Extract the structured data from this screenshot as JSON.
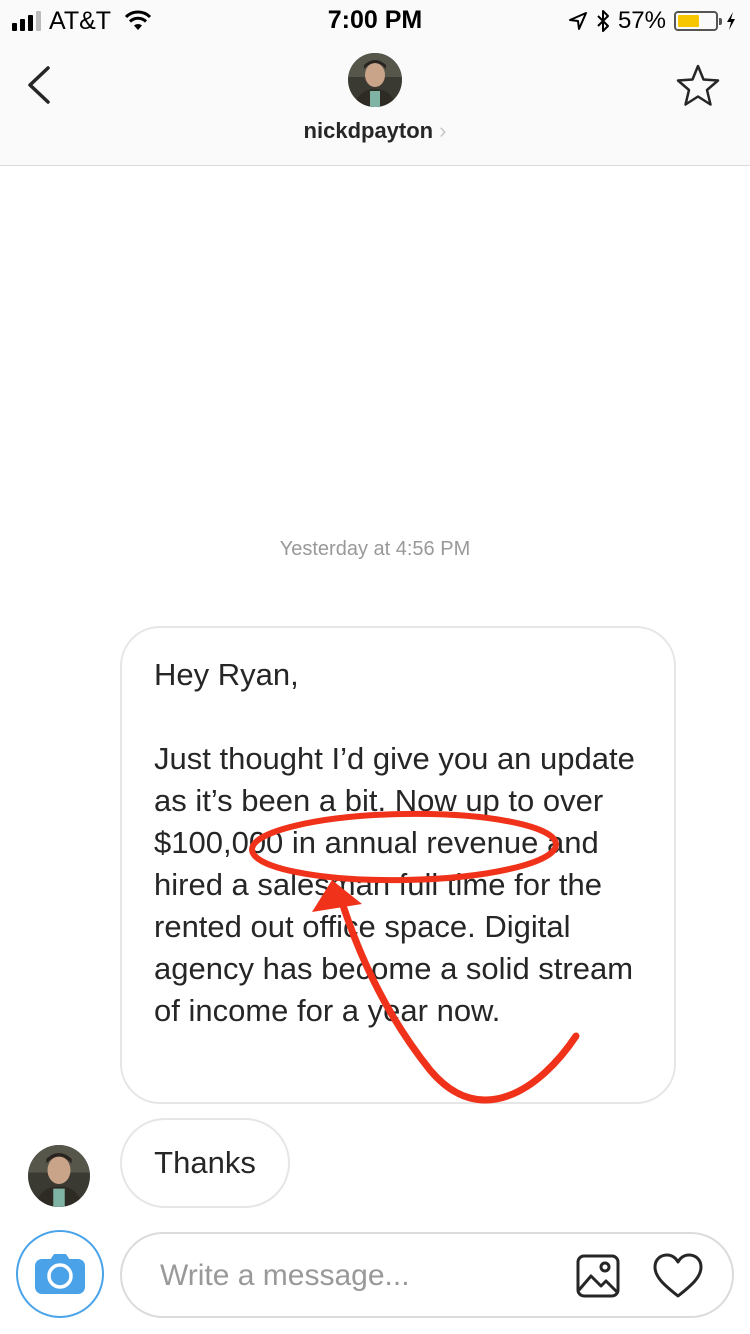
{
  "status_bar": {
    "carrier": "AT&T",
    "time": "7:00 PM",
    "battery_percent": "57%",
    "battery_level": 0.57,
    "battery_color": "#f7c600",
    "icons": [
      "signal-icon",
      "wifi-icon",
      "location-icon",
      "bluetooth-icon",
      "battery-icon",
      "charging-icon"
    ]
  },
  "header": {
    "username": "nickdpayton",
    "chevron": "›",
    "icons": [
      "back-icon",
      "star-icon",
      "avatar"
    ]
  },
  "conversation": {
    "timestamp": "Yesterday at 4:56 PM",
    "messages": [
      {
        "text": "Hey Ryan,\n\nJust thought I’d give you an update as it’s been a bit. Now up to over $100,000 in annual revenue and hired a salesman full time for the rented out office space. Digital agency has become a solid stream of income for a year now."
      },
      {
        "text": "Thanks"
      }
    ],
    "annotation_color": "#f0321a"
  },
  "composer": {
    "placeholder": "Write a message...",
    "value": "",
    "accent_color": "#4aa3e8",
    "icons": [
      "camera-icon",
      "image-icon",
      "heart-icon"
    ]
  }
}
